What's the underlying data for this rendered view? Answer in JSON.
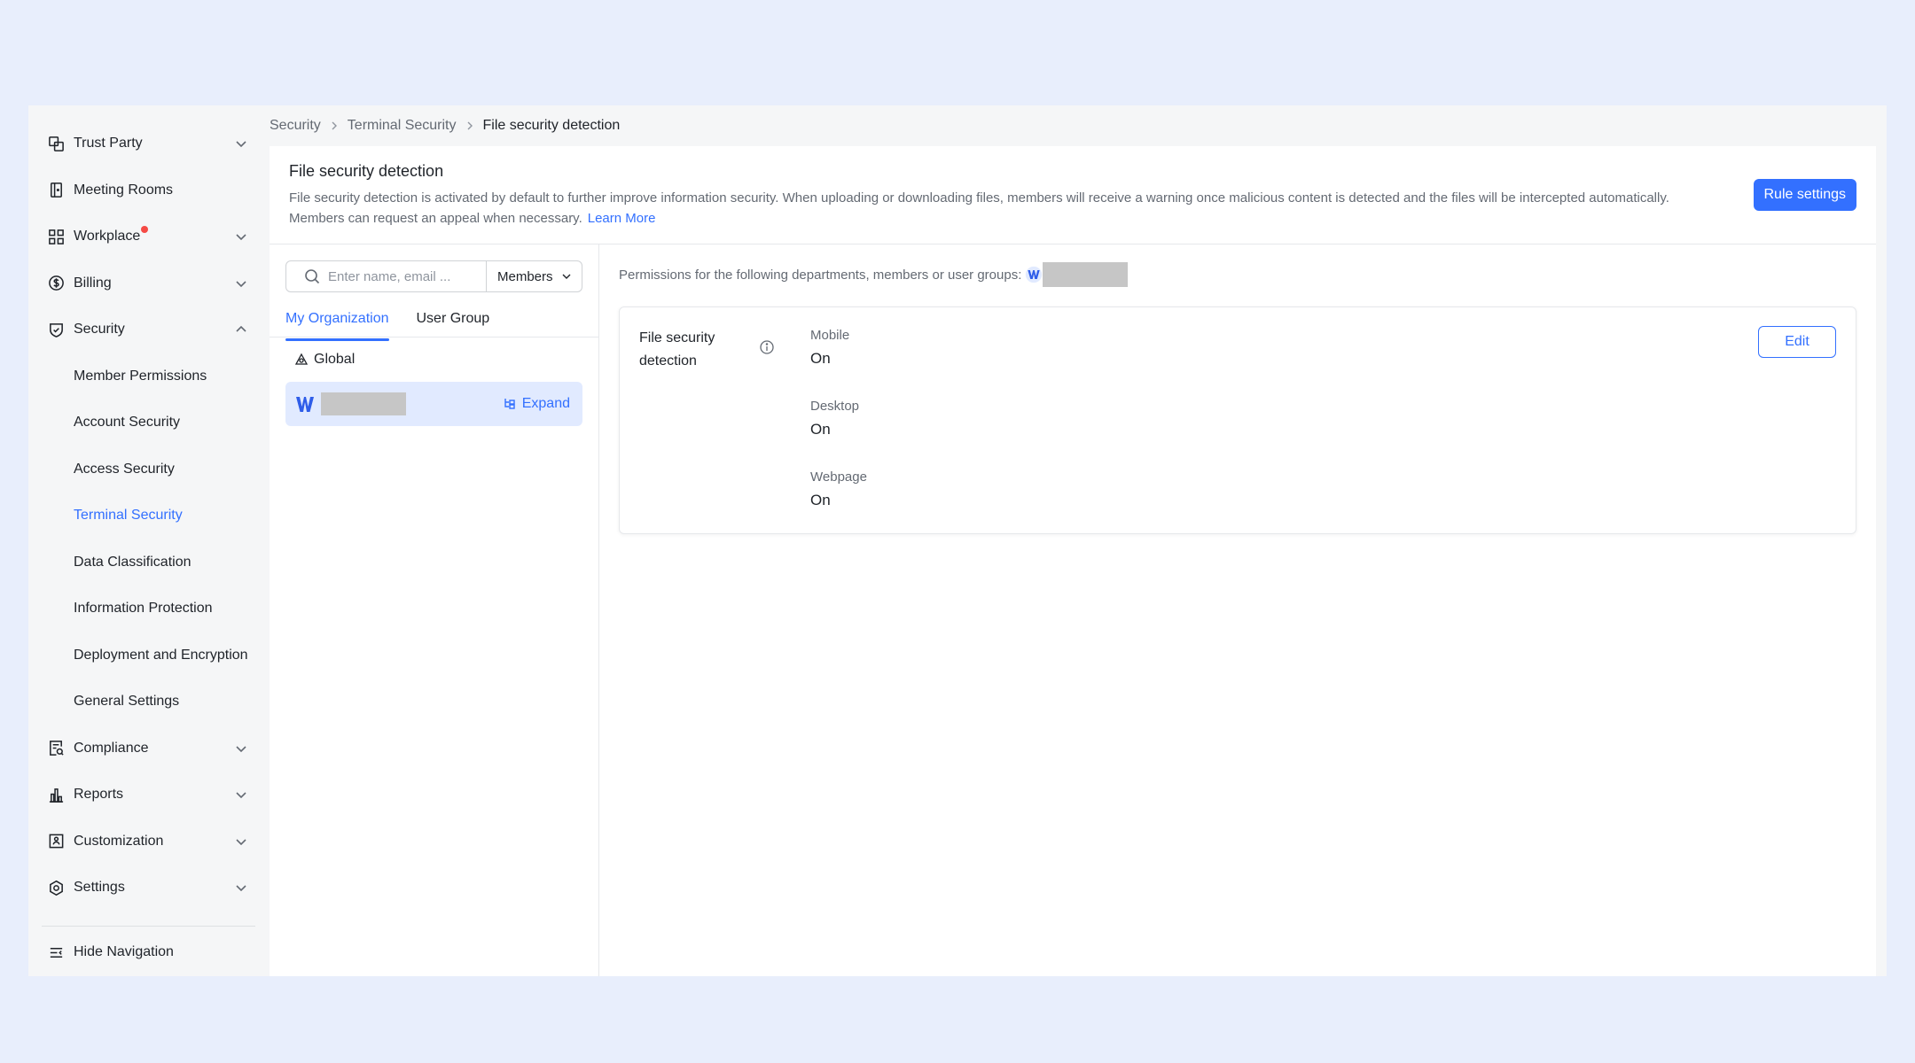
{
  "colors": {
    "accent": "#3370ff",
    "badge": "#f54a45",
    "page_bg": "#e8eefc"
  },
  "sidebar": {
    "items": [
      {
        "label": "Trust Party",
        "icon": "trust-party-icon",
        "chevron": "down"
      },
      {
        "label": "Meeting Rooms",
        "icon": "meeting-rooms-icon"
      },
      {
        "label": "Workplace",
        "icon": "workplace-icon",
        "chevron": "down",
        "badge": true
      },
      {
        "label": "Billing",
        "icon": "billing-icon",
        "chevron": "down"
      },
      {
        "label": "Security",
        "icon": "security-shield-icon",
        "chevron": "up"
      }
    ],
    "security_sub": [
      "Member Permissions",
      "Account Security",
      "Access Security",
      "Terminal Security",
      "Data Classification",
      "Information Protection",
      "Deployment and Encryption",
      "General Settings"
    ],
    "active_sub": "Terminal Security",
    "items_after": [
      {
        "label": "Compliance",
        "icon": "compliance-icon",
        "chevron": "down"
      },
      {
        "label": "Reports",
        "icon": "reports-icon",
        "chevron": "down"
      },
      {
        "label": "Customization",
        "icon": "customization-icon",
        "chevron": "down"
      },
      {
        "label": "Settings",
        "icon": "settings-gear-icon",
        "chevron": "down"
      }
    ],
    "hide_navigation": "Hide Navigation"
  },
  "breadcrumb": [
    "Security",
    "Terminal Security",
    "File security detection"
  ],
  "header": {
    "title": "File security detection",
    "description": "File security detection is activated by default to further improve information security. When uploading or downloading files, members will receive a warning once malicious content is detected and the files will be intercepted automatically. Members can request an appeal when necessary.",
    "learn_more": "Learn More",
    "rule_settings": "Rule settings"
  },
  "left_panel": {
    "search_placeholder": "Enter name, email ...",
    "filter_select": "Members",
    "tabs": [
      "My Organization",
      "User Group"
    ],
    "global_label": "Global",
    "expand_label": "Expand"
  },
  "right_panel": {
    "permissions_text": "Permissions for the following departments, members or user groups:",
    "card": {
      "label": "File security detection",
      "edit": "Edit",
      "fields": [
        {
          "name": "Mobile",
          "value": "On"
        },
        {
          "name": "Desktop",
          "value": "On"
        },
        {
          "name": "Webpage",
          "value": "On"
        }
      ]
    }
  }
}
